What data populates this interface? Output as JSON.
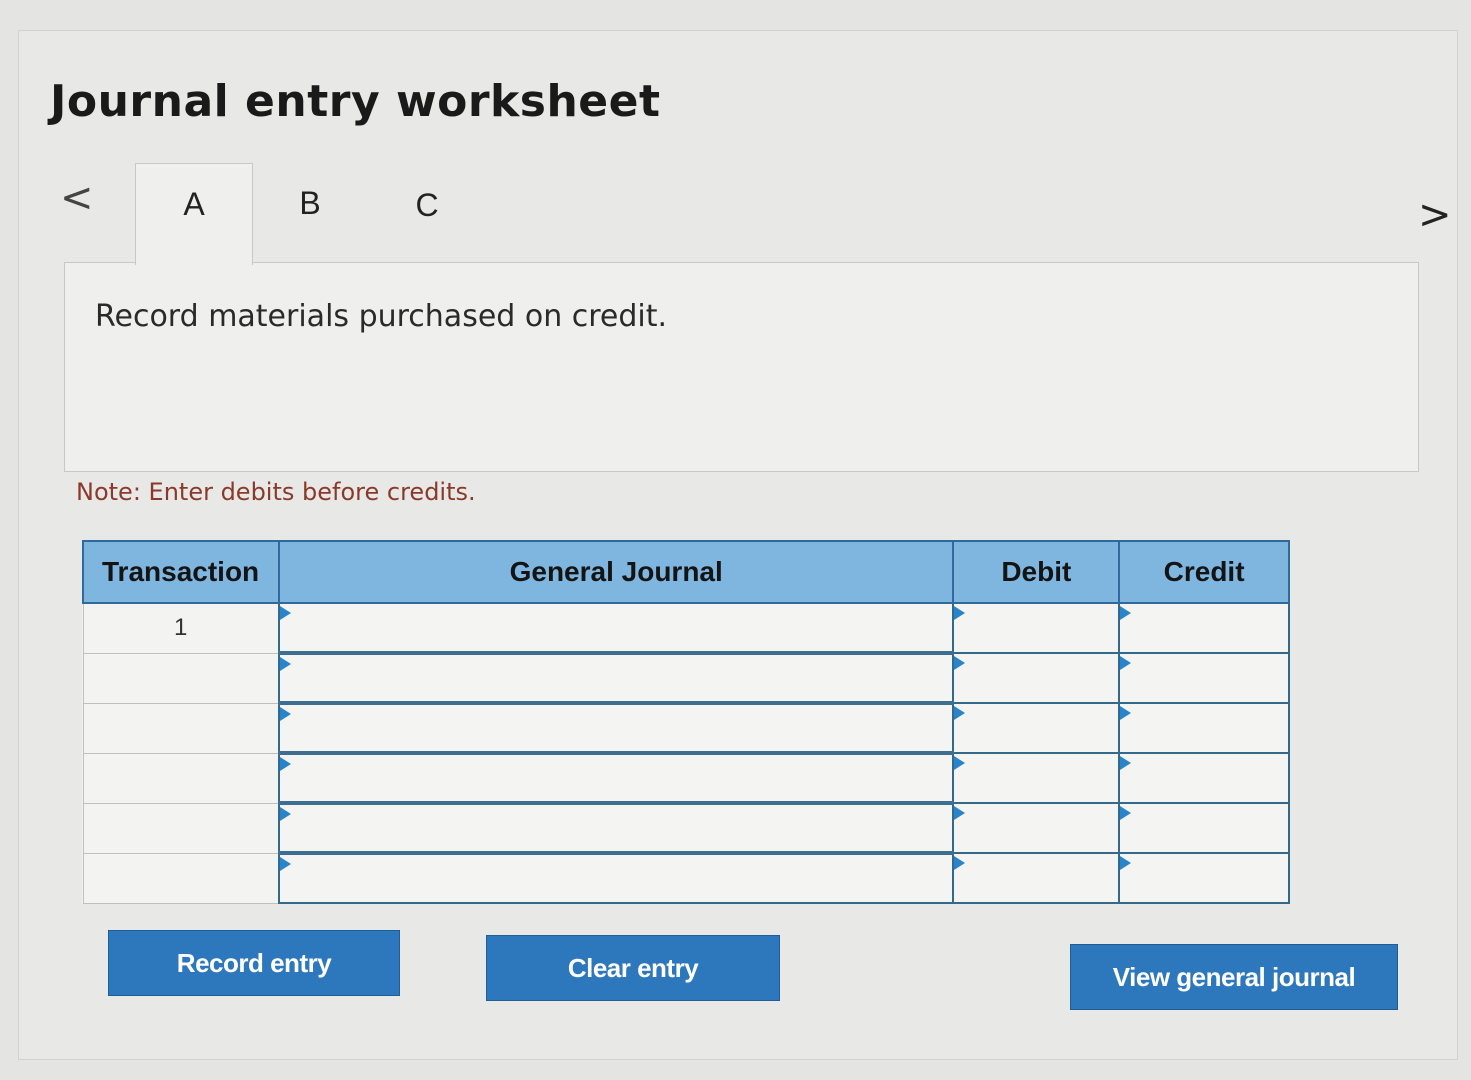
{
  "page": {
    "title": "Journal entry worksheet"
  },
  "nav": {
    "prev_icon": "chevron-left-icon",
    "next_icon": "chevron-right-icon",
    "prev_glyph": "<",
    "next_glyph": ">"
  },
  "tabs": [
    {
      "label": "A",
      "active": true
    },
    {
      "label": "B",
      "active": false
    },
    {
      "label": "C",
      "active": false
    }
  ],
  "instruction": "Record materials purchased on credit.",
  "note": "Note: Enter debits before credits.",
  "table": {
    "headers": {
      "transaction": "Transaction",
      "general_journal": "General Journal",
      "debit": "Debit",
      "credit": "Credit"
    },
    "rows": [
      {
        "transaction": "1",
        "general_journal": "",
        "debit": "",
        "credit": ""
      },
      {
        "transaction": "",
        "general_journal": "",
        "debit": "",
        "credit": ""
      },
      {
        "transaction": "",
        "general_journal": "",
        "debit": "",
        "credit": ""
      },
      {
        "transaction": "",
        "general_journal": "",
        "debit": "",
        "credit": ""
      },
      {
        "transaction": "",
        "general_journal": "",
        "debit": "",
        "credit": ""
      },
      {
        "transaction": "",
        "general_journal": "",
        "debit": "",
        "credit": ""
      }
    ]
  },
  "buttons": {
    "record": "Record entry",
    "clear": "Clear entry",
    "view": "View general journal"
  },
  "colors": {
    "header_bg": "#7fb6e0",
    "button_bg": "#2d77bd",
    "note_text": "#8a3a2a",
    "input_marker": "#2a84c9"
  }
}
